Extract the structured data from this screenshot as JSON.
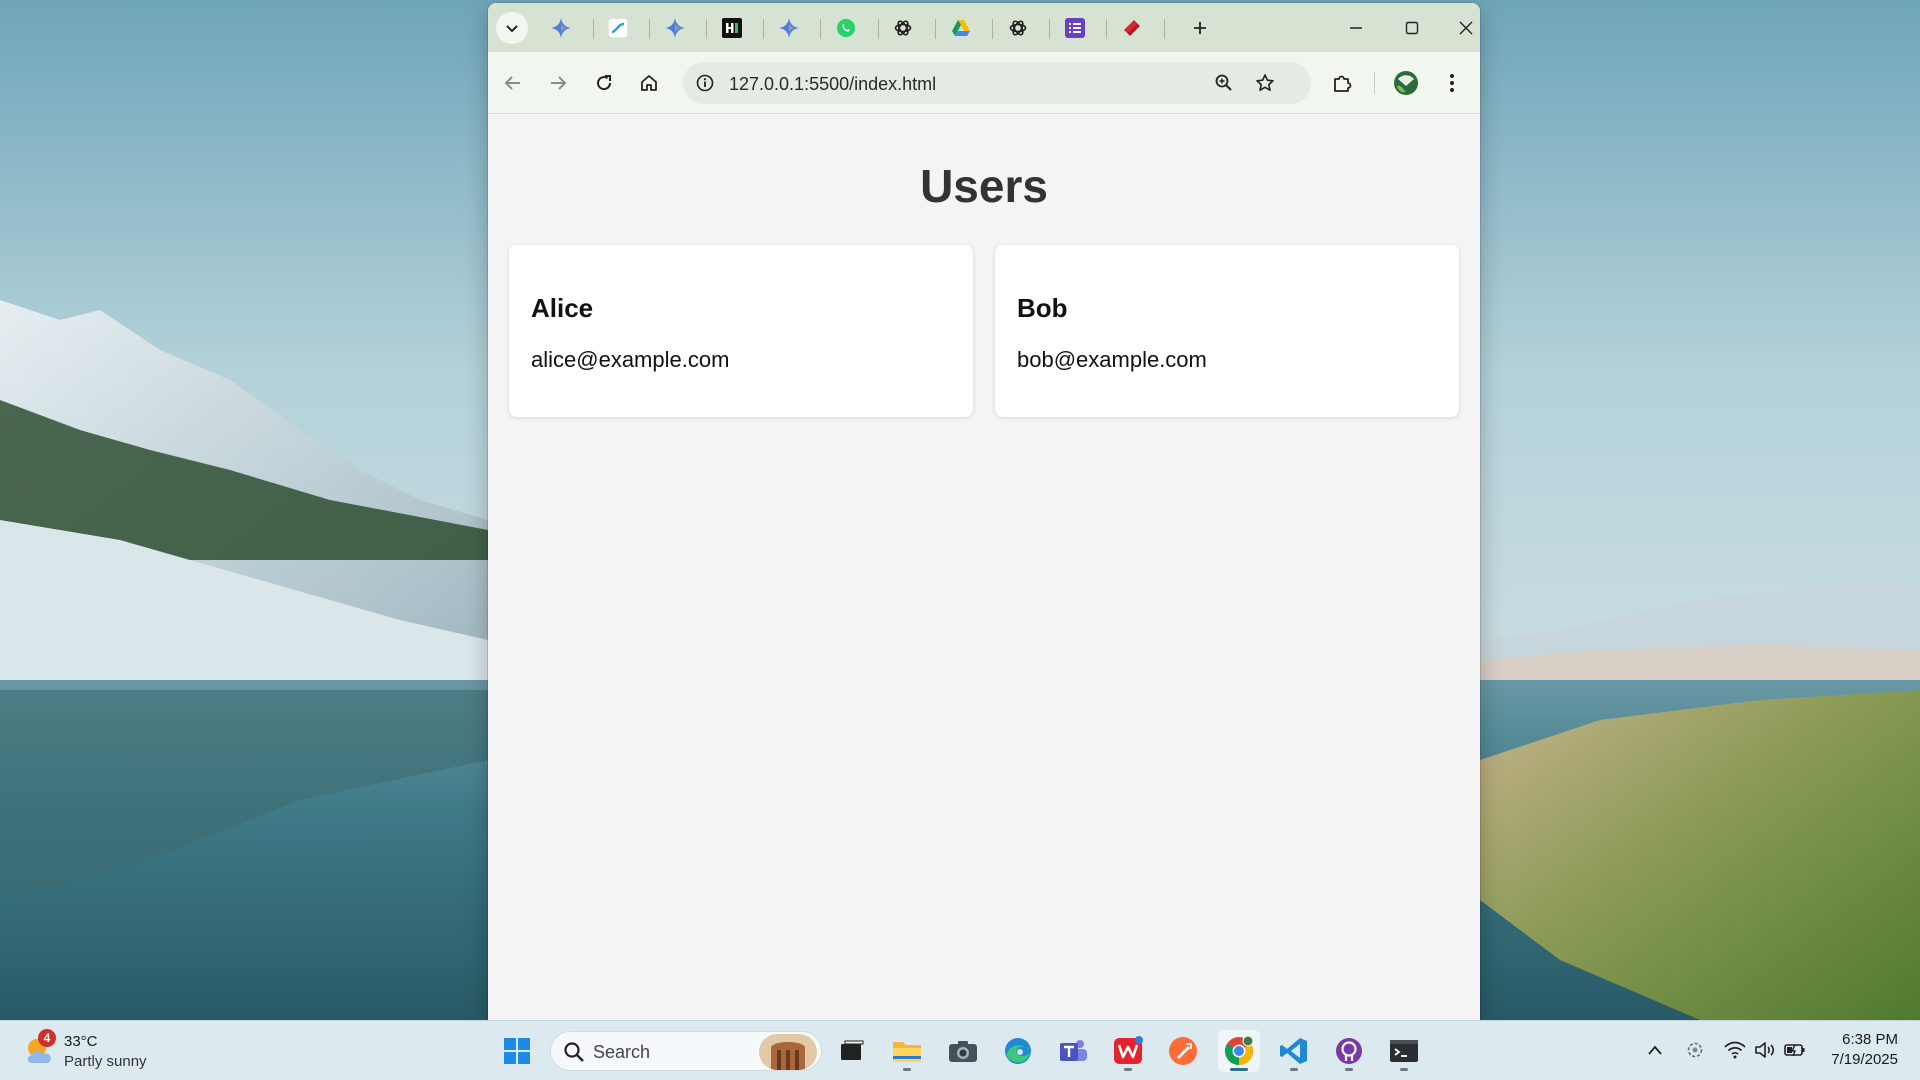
{
  "browser": {
    "url": "127.0.0.1:5500/index.html",
    "tabs": [
      {
        "icon": "gemini-icon"
      },
      {
        "icon": "flow-icon"
      },
      {
        "icon": "gemini-icon"
      },
      {
        "icon": "hashnode-icon"
      },
      {
        "icon": "gemini-icon"
      },
      {
        "icon": "whatsapp-icon"
      },
      {
        "icon": "openai-icon"
      },
      {
        "icon": "google-drive-icon"
      },
      {
        "icon": "openai-icon"
      },
      {
        "icon": "forms-icon"
      },
      {
        "icon": "stack-icon"
      }
    ]
  },
  "page": {
    "title": "Users",
    "users": [
      {
        "name": "Alice",
        "email": "alice@example.com"
      },
      {
        "name": "Bob",
        "email": "bob@example.com"
      }
    ]
  },
  "taskbar": {
    "weather": {
      "temp": "33°C",
      "condition": "Partly sunny",
      "badge": "4"
    },
    "search_label": "Search",
    "apps": [
      {
        "name": "start-icon"
      },
      {
        "name": "task-view-icon"
      },
      {
        "name": "file-explorer-icon"
      },
      {
        "name": "camera-icon"
      },
      {
        "name": "edge-icon"
      },
      {
        "name": "teams-icon"
      },
      {
        "name": "wps-office-icon"
      },
      {
        "name": "postman-icon"
      },
      {
        "name": "chrome-icon"
      },
      {
        "name": "vscode-icon"
      },
      {
        "name": "github-desktop-icon"
      },
      {
        "name": "terminal-icon"
      }
    ],
    "time": "6:38 PM",
    "date": "7/19/2025"
  },
  "colors": {
    "tabstrip": "#d6e3d3",
    "toolbar": "#f1f6ef",
    "page_background": "#f4f4f4",
    "card_background": "#ffffff",
    "taskbar": "#dce9ef"
  }
}
